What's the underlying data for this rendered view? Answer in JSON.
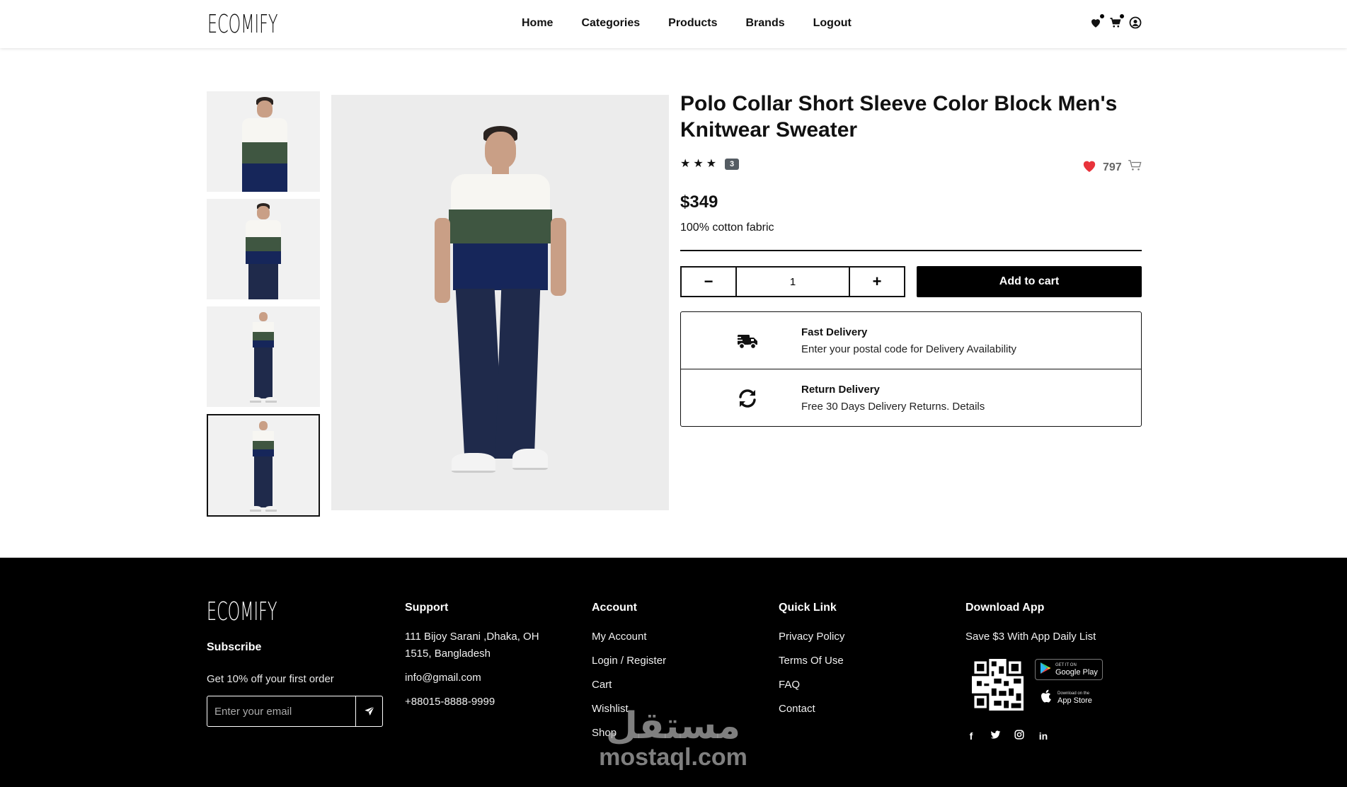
{
  "header": {
    "logo": "ECOMIFY",
    "nav": [
      "Home",
      "Categories",
      "Products",
      "Brands",
      "Logout"
    ],
    "icons": [
      "heart-icon",
      "cart-icon",
      "user-icon"
    ]
  },
  "product": {
    "title": "Polo Collar Short Sleeve Color Block Men's Knitwear Sweater",
    "rating_stars": 3,
    "rating_count": "3",
    "likes": "797",
    "price": "$349",
    "description": "100% cotton fabric",
    "quantity": "1",
    "minus_label": "−",
    "plus_label": "+",
    "add_to_cart": "Add to cart",
    "thumbnails": 4,
    "active_thumbnail": 4
  },
  "delivery": {
    "fast_title": "Fast Delivery",
    "fast_text": "Enter your postal code for Delivery Availability",
    "return_title": "Return Delivery",
    "return_text": "Free 30 Days Delivery Returns. Details"
  },
  "footer": {
    "logo": "ECOMIFY",
    "subscribe_title": "Subscribe",
    "subscribe_text": "Get 10% off your first order",
    "email_placeholder": "Enter your email",
    "support": {
      "heading": "Support",
      "address": "111 Bijoy Sarani ,Dhaka, OH 1515, Bangladesh",
      "email": "info@gmail.com",
      "phone": "+88015-8888-9999"
    },
    "account": {
      "heading": "Account",
      "links": [
        "My Account",
        "Login / Register",
        "Cart",
        "Wishlist",
        "Shop"
      ]
    },
    "quick_link": {
      "heading": "Quick Link",
      "links": [
        "Privacy Policy",
        "Terms Of Use",
        "FAQ",
        "Contact"
      ]
    },
    "download": {
      "heading": "Download App",
      "text": "Save $3 With App Daily List",
      "google_small": "GET IT ON",
      "google_big": "Google Play",
      "apple_small": "Download on the",
      "apple_big": "App Store"
    },
    "socials": [
      "facebook-icon",
      "twitter-icon",
      "instagram-icon",
      "linkedin-icon"
    ]
  },
  "watermark": {
    "arabic": "مستقل",
    "latin": "mostaql.com"
  },
  "colors": {
    "accent": "#000000",
    "heart": "#e8333b",
    "badge": "#555c63",
    "shirt_top": "#f7f6f2",
    "shirt_mid": "#3f5641",
    "shirt_bottom": "#16265a"
  }
}
